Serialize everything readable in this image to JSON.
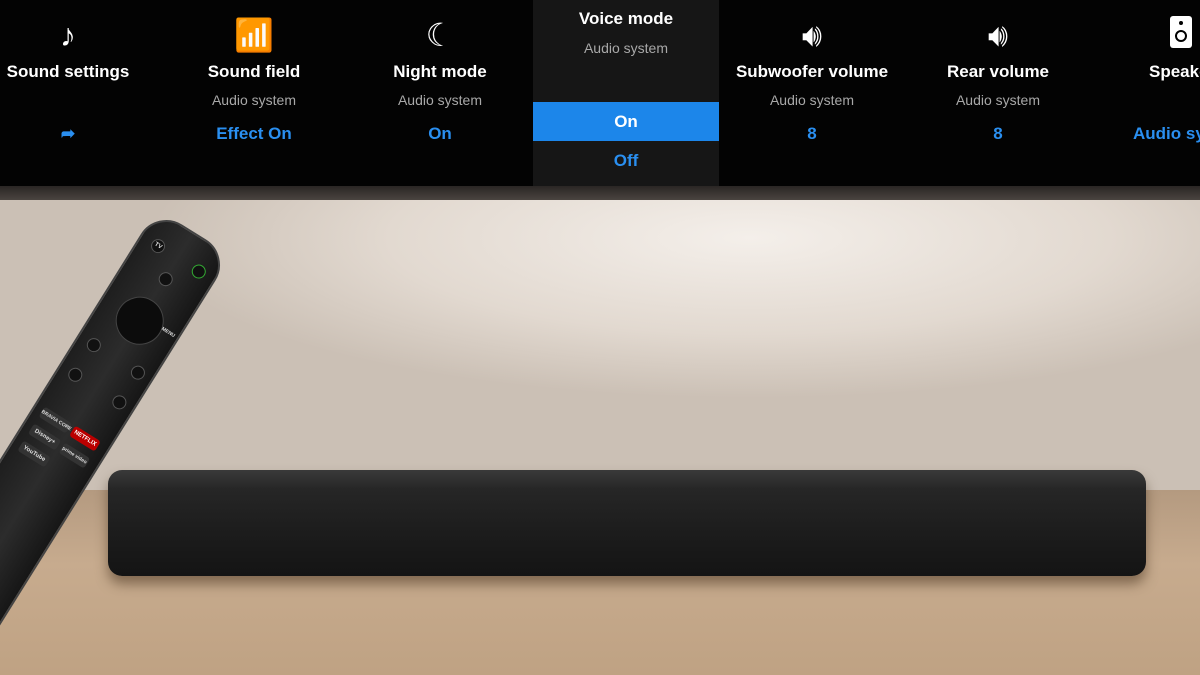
{
  "menu": {
    "items": [
      {
        "icon": "music-note-icon",
        "title": "Sound settings",
        "subtitle": "",
        "value": "➦"
      },
      {
        "icon": "sound-field-icon",
        "title": "Sound field",
        "subtitle": "Audio system",
        "value": "Effect On"
      },
      {
        "icon": "night-mode-icon",
        "title": "Night mode",
        "subtitle": "Audio system",
        "value": "On"
      },
      {
        "icon": "speaker-volume-icon",
        "title": "Subwoofer volume",
        "subtitle": "Audio system",
        "value": "8"
      },
      {
        "icon": "speaker-volume-icon",
        "title": "Rear volume",
        "subtitle": "Audio system",
        "value": "8"
      },
      {
        "icon": "speaker-icon",
        "title": "Speake",
        "subtitle": "",
        "value": "Audio sy"
      }
    ],
    "voice_mode": {
      "title": "Voice mode",
      "subtitle": "Audio system",
      "options": [
        "On",
        "Off"
      ],
      "selected": "On"
    }
  },
  "colors": {
    "accent": "#1c86ea",
    "value_text": "#2a8ff0",
    "panel": "#030303"
  },
  "remote_logos": [
    "TV",
    "MENU",
    "NETFLIX",
    "Disney+",
    "prime video",
    "YouTube",
    "BRAVIA CORE"
  ]
}
